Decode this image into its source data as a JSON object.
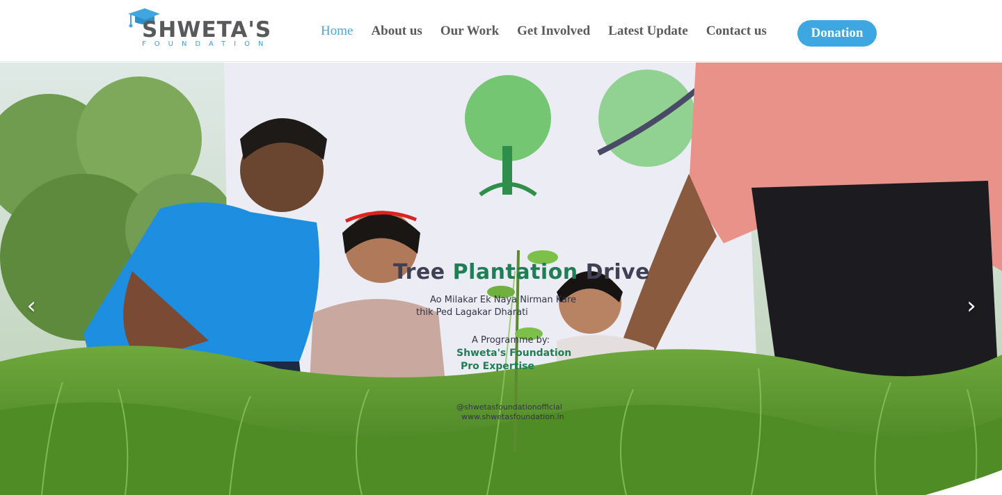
{
  "header": {
    "logo": {
      "name": "SHWETA'S",
      "subtitle": "FOUNDATION",
      "icon": "graduation-cap-icon"
    },
    "nav": [
      {
        "label": "Home",
        "active": true
      },
      {
        "label": "About us",
        "active": false
      },
      {
        "label": "Our Work",
        "active": false
      },
      {
        "label": "Get Involved",
        "active": false
      },
      {
        "label": "Latest Update",
        "active": false
      },
      {
        "label": "Contact us",
        "active": false
      }
    ],
    "cta_label": "Donation"
  },
  "hero": {
    "banner": {
      "title_prefix": "Tree",
      "title_highlight": "Plantation",
      "title_suffix": "Drive",
      "lines": [
        "Ao Milakar Ek Naya Nirman Kare",
        "thik Ped Lagakar Dharati",
        "A Programme by:",
        "Shweta's Foundation",
        "Pro Expertise",
        "@shwetasfoundationofficial",
        "www.shwetasfoundation.in"
      ]
    },
    "prev_icon": "chevron-left-icon",
    "next_icon": "chevron-right-icon",
    "prev_glyph": "‹",
    "next_glyph": "›"
  },
  "colors": {
    "accent": "#3ea7e1",
    "nav_text": "#5a5a5a",
    "nav_active": "#49a7da",
    "logo_gray": "#58595b"
  }
}
